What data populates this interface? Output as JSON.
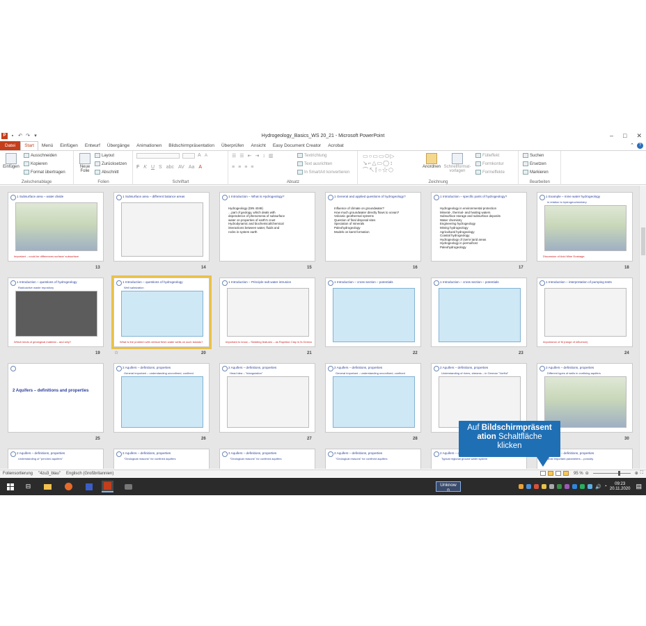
{
  "window": {
    "title": "Hydrogeology_Basics_WS 20_21  -  Microsoft PowerPoint",
    "quick_access_icon": "ppt-icon",
    "controls": [
      "–",
      "□",
      "✕"
    ]
  },
  "tabs": [
    "Datei",
    "Start",
    "Menü",
    "Einfügen",
    "Entwurf",
    "Übergänge",
    "Animationen",
    "Bildschirmpräsentation",
    "Überprüfen",
    "Ansicht",
    "Easy Document Creator",
    "Acrobat"
  ],
  "ribbon": {
    "clipboard": {
      "label": "Zwischenablage",
      "paste": "Einfügen",
      "cut": "Ausschneiden",
      "copy": "Kopieren",
      "format": "Format übertragen"
    },
    "slides": {
      "label": "Folien",
      "new_slide": "Neue Folie",
      "layout": "Layout",
      "reset": "Zurücksetzen",
      "section": "Abschnitt"
    },
    "font": {
      "label": "Schriftart"
    },
    "paragraph": {
      "label": "Absatz",
      "text_direction": "Textrichtung",
      "align_text": "Text ausrichten",
      "smartart": "In SmartArt konvertieren"
    },
    "drawing": {
      "label": "Zeichnung",
      "arrange": "Anordnen",
      "quick_styles": "Schnellformat-vorlagen",
      "fill": "Fülleffekt",
      "outline": "Formkontur",
      "effects": "Formeffekte"
    },
    "editing": {
      "label": "Bearbeiten",
      "find": "Suchen",
      "replace": "Ersetzen",
      "select": "Markieren"
    }
  },
  "slides": [
    {
      "num": "13",
      "title": "1 Subsurface area – water divide",
      "sub": "",
      "bullets": [],
      "foot": "Important – could be differences surface/ subsurface",
      "fig": "geo"
    },
    {
      "num": "14",
      "title": "1 Subsurface area – different balance areas",
      "sub": "",
      "bullets": [],
      "foot": "",
      "fig": "map"
    },
    {
      "num": "15",
      "title": "1 Introduction – What is Hydrogeology?",
      "sub": "",
      "bullets": [
        "Hydrogeology (DIN 4049)",
        "…part of geology, which deals with",
        "dependence of phenomena of subsurface",
        "water on properties of earth's crust",
        "",
        "Hydrodynamic and biochemical/chemical",
        "interactions between water, fluids and",
        "rocks in system earth"
      ],
      "foot": "",
      "fig": "none"
    },
    {
      "num": "16",
      "title": "1 General and applied questions of hydrogeology?",
      "sub": "",
      "bullets": [
        "Influence of climate on groundwater?",
        "How much groundwater directly flows to ocean?",
        "Volcanic geothermal systems",
        "Question of final disposal sites",
        "Speciation of minerals",
        "Paleohydrogeology",
        "Models on karst formation"
      ],
      "foot": "",
      "fig": "none"
    },
    {
      "num": "17",
      "title": "1 Introduction – specific parts of hydrogeology?",
      "sub": "",
      "bullets": [
        "Hydrogeology in environmental protection",
        "Mineral-, thermal- and healing waters",
        "Subsurface storage and subsurface deposits",
        "Water chemistry",
        "Engineering hydrogeology",
        "Mining hydrogeology",
        "Agricultural hydrogeology",
        "Coastal hydrogeology",
        "Hydrogeology of (semi-)arid areas",
        "Hydrogeology in permafrost",
        "Paleohydrogeology"
      ],
      "foot": "",
      "fig": "none"
    },
    {
      "num": "18",
      "title": "1 Example – mine water hydrogeology",
      "sub": "in relation to hydrogeochemistry",
      "bullets": [],
      "foot": "Discussion of Acid Mine Drainage",
      "fig": "geo"
    },
    {
      "num": "19",
      "title": "1 Introduction – questions of hydrogeology",
      "sub": "Radioactive waste repository",
      "bullets": [],
      "foot": "Which kinds of geological material – and why?",
      "fig": "dark"
    },
    {
      "num": "20",
      "title": "1 Introduction – questions of hydrogeology",
      "sub": "Well salinization",
      "bullets": [],
      "foot": "What is the problem with vertical fresh water wells on such islands?",
      "fig": "blue"
    },
    {
      "num": "21",
      "title": "1 Introduction – Principle salt water intrusion",
      "sub": "",
      "bullets": [],
      "foot": "Important to know – Skidding features – as Rupelian Clay in N-Germany",
      "fig": "map"
    },
    {
      "num": "22",
      "title": "1 Introduction – cross section – potentials",
      "sub": "",
      "bullets": [],
      "foot": "",
      "fig": "blue"
    },
    {
      "num": "23",
      "title": "1 Introduction – cross section – potentials",
      "sub": "",
      "bullets": [],
      "foot": "",
      "fig": "blue"
    },
    {
      "num": "24",
      "title": "1 Introduction – interpretation of pumping tests",
      "sub": "",
      "bullets": [],
      "foot": "Importance of M (range of influence)",
      "fig": "map"
    },
    {
      "num": "25",
      "title": "",
      "sub": "",
      "bullets": [],
      "foot": "",
      "fig": "none",
      "big": "2 Aquifers  – definitions  and  properties"
    },
    {
      "num": "26",
      "title": "2 Aquifers – definitions, properties",
      "sub": "General important – understanding unconfined, confined",
      "bullets": [],
      "foot": "",
      "fig": "blue"
    },
    {
      "num": "27",
      "title": "2 Aquifers – definitions, properties",
      "sub": "Head idea – \"triangulation\"",
      "bullets": [],
      "foot": "",
      "fig": "map"
    },
    {
      "num": "28",
      "title": "2 Aquifers – definitions, properties",
      "sub": "General important – understanding unconfined, confined",
      "bullets": [],
      "foot": "",
      "fig": "blue"
    },
    {
      "num": "29",
      "title": "2 Aquifers – definitions, properties",
      "sub": "Understanding of rivers, streams – in German \"Vorflut\"",
      "bullets": [],
      "foot": "",
      "fig": "map"
    },
    {
      "num": "30",
      "title": "2 Aquifers – definitions, properties",
      "sub": "Different types of wells in confining aquifers",
      "bullets": [],
      "foot": "",
      "fig": "geo"
    },
    {
      "num": "",
      "title": "2 Aquifers – definitions, properties",
      "sub": "Understanding of \"perched aquifers\"",
      "bullets": [],
      "foot": "",
      "fig": "none"
    },
    {
      "num": "",
      "title": "2 Aquifers – definitions, properties",
      "sub": "\"Geological reasons\" for confined aquifers",
      "bullets": [],
      "foot": "",
      "fig": "none"
    },
    {
      "num": "",
      "title": "2 Aquifers – definitions, properties",
      "sub": "\"Geological reasons\" for confined aquifers",
      "bullets": [],
      "foot": "",
      "fig": "none"
    },
    {
      "num": "",
      "title": "2 Aquifers – definitions, properties",
      "sub": "\"Geological reasons\" for confined aquifers",
      "bullets": [],
      "foot": "",
      "fig": "none"
    },
    {
      "num": "",
      "title": "2 Aquifers – definitions, properties",
      "sub": "Typical regional ground water system",
      "bullets": [],
      "foot": "",
      "fig": "none"
    },
    {
      "num": "",
      "title": "2 Aquifers – definitions, properties",
      "sub": "Most important parameters – porosity",
      "bullets": [],
      "foot": "",
      "fig": "none"
    }
  ],
  "tooltip": {
    "line1": "Auf ",
    "line1_bold": "Bildschirmpräsent",
    "line2_bold": "ation",
    "line2": " Schaltfläche",
    "line3": "klicken"
  },
  "status": {
    "view": "Foliensortierung",
    "theme": "\"4zu3_blau\"",
    "language": "Englisch (Großbritannien)",
    "zoom": "95 %"
  },
  "taskbar": {
    "unknown_line1": "Unknow",
    "unknown_line2": "n",
    "time": "09:23",
    "date": "20.11.2020"
  },
  "colors": {
    "accent": "#c43e1c",
    "slide_title": "#2a3f9a",
    "selection": "#e8c14a",
    "tooltip": "#1f6fb5"
  }
}
